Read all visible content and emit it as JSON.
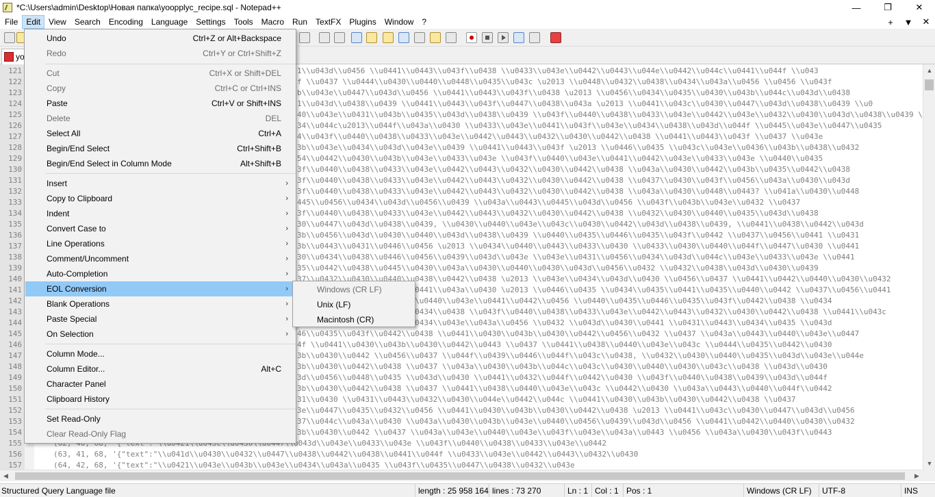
{
  "window": {
    "title": "*C:\\Users\\admin\\Desktop\\Новая папка\\yoopplyc_recipe.sql - Notepad++",
    "minimize": "—",
    "restore": "❐",
    "close": "✕"
  },
  "menubar": {
    "items": [
      "File",
      "Edit",
      "View",
      "Search",
      "Encoding",
      "Language",
      "Settings",
      "Tools",
      "Macro",
      "Run",
      "TextFX",
      "Plugins",
      "Window",
      "?"
    ],
    "right": [
      "+",
      "▼",
      "✕"
    ]
  },
  "tab": {
    "label": "yo"
  },
  "edit_menu": {
    "items": [
      {
        "label": "Undo",
        "shortcut": "Ctrl+Z or Alt+Backspace",
        "disabled": false
      },
      {
        "label": "Redo",
        "shortcut": "Ctrl+Y or Ctrl+Shift+Z",
        "disabled": true
      },
      {
        "label": "Cut",
        "shortcut": "Ctrl+X or Shift+DEL",
        "disabled": true
      },
      {
        "label": "Copy",
        "shortcut": "Ctrl+C or Ctrl+INS",
        "disabled": true
      },
      {
        "label": "Paste",
        "shortcut": "Ctrl+V or Shift+INS",
        "disabled": false
      },
      {
        "label": "Delete",
        "shortcut": "DEL",
        "disabled": true
      },
      {
        "label": "Select All",
        "shortcut": "Ctrl+A",
        "disabled": false
      },
      {
        "label": "Begin/End Select",
        "shortcut": "Ctrl+Shift+B",
        "disabled": false
      },
      {
        "label": "Begin/End Select in Column Mode",
        "shortcut": "Alt+Shift+B",
        "disabled": false
      },
      {
        "label": "Insert",
        "submenu": true
      },
      {
        "label": "Copy to Clipboard",
        "submenu": true
      },
      {
        "label": "Indent",
        "submenu": true
      },
      {
        "label": "Convert Case to",
        "submenu": true
      },
      {
        "label": "Line Operations",
        "submenu": true
      },
      {
        "label": "Comment/Uncomment",
        "submenu": true
      },
      {
        "label": "Auto-Completion",
        "submenu": true
      },
      {
        "label": "EOL Conversion",
        "submenu": true,
        "highlighted": true
      },
      {
        "label": "Blank Operations",
        "submenu": true
      },
      {
        "label": "Paste Special",
        "submenu": true
      },
      {
        "label": "On Selection",
        "submenu": true
      },
      {
        "label": "Column Mode...",
        "shortcut": ""
      },
      {
        "label": "Column Editor...",
        "shortcut": "Alt+C"
      },
      {
        "label": "Character Panel",
        "shortcut": ""
      },
      {
        "label": "Clipboard History",
        "shortcut": ""
      },
      {
        "label": "Set Read-Only",
        "shortcut": ""
      },
      {
        "label": "Clear Read-Only Flag",
        "shortcut": "",
        "disabled": true
      }
    ]
  },
  "eol_submenu": {
    "items": [
      {
        "label": "Windows (CR LF)",
        "disabled": true
      },
      {
        "label": "Unix (LF)",
        "disabled": false
      },
      {
        "label": "Macintosh (CR)",
        "disabled": false
      }
    ]
  },
  "editor": {
    "lines": [
      {
        "n": "121",
        "text": "1\\\\u043d\\\\u0456 \\\\u0441\\\\u0443\\\\u043f\\\\u0438 \\\\u0433\\\\u043e\\\\u0442\\\\u0443\\\\u044e\\\\u0442\\\\u044c\\\\u0441\\\\u044f \\\\u043"
      },
      {
        "n": "122",
        "text": "f \\\\u0437 \\\\u0444\\\\u0430\\\\u0440\\\\u0448\\\\u0435\\\\u043c \\u2013 \\\\u0448\\\\u0432\\\\u0438\\\\u0434\\\\u043a\\\\u0456 \\\\u0456 \\\\u043f"
      },
      {
        "n": "123",
        "text": "b\\\\u043e\\\\u0447\\\\u043d\\\\u0456 \\\\u0441\\\\u0443\\\\u043f\\\\u0438 \\u2013 \\\\u0456\\\\u0434\\\\u0435\\\\u0430\\\\u043b\\\\u044c\\\\u043d\\\\u0438"
      },
      {
        "n": "124",
        "text": "1\\\\u043d\\\\u0438\\\\u0439 \\\\u0441\\\\u0443\\\\u043f\\\\u0447\\\\u0438\\\\u043a \\u2013 \\\\u0441\\\\u043c\\\\u0430\\\\u0447\\\\u043d\\\\u0438\\\\u0439 \\\\u0"
      },
      {
        "n": "125",
        "text": "40\\\\u043e\\\\u0431\\\\u043b\\\\u0435\\\\u043d\\\\u0438\\\\u0439 \\\\u043f\\\\u0440\\\\u0438\\\\u0433\\\\u043e\\\\u0442\\\\u043e\\\\u0432\\\\u0430\\\\u043d\\\\u0438\\\\u0439 \\\\u0"
      },
      {
        "n": "126",
        "text": "34\\\\u044c\\u2013\\\\u044f\\\\u043a\\\\u0430 \\\\u0433\\\\u043e\\\\u0441\\\\u043f\\\\u043e\\\\u0434\\\\u0438\\\\u043d\\\\u044f \\\\u0445\\\\u043e\\\\u0447\\\\u0435"
      },
      {
        "n": "127",
        "text": "4\\\\u043f\\\\u0440\\\\u0438\\\\u0433\\\\u043e\\\\u0442\\\\u0443\\\\u0432\\\\u0430\\\\u0442\\\\u0438 \\\\u0441\\\\u0443\\\\u043f \\\\u0437 \\\\u043e"
      },
      {
        "n": "128",
        "text": "3b\\\\u043e\\\\u0434\\\\u043d\\\\u043e\\\\u0439 \\\\u0441\\\\u0443\\\\u043f \\u2013 \\\\u0446\\\\u0435 \\\\u043c\\\\u043e\\\\u0436\\\\u043b\\\\u0438\\\\u0432"
      },
      {
        "n": "129",
        "text": "54\\\\u0442\\\\u0430\\\\u043b\\\\u043e\\\\u0433\\\\u043e \\\\u043f\\\\u0440\\\\u043e\\\\u0441\\\\u0442\\\\u043e\\\\u0433\\\\u043e \\\\u0440\\\\u0435"
      },
      {
        "n": "130",
        "text": "3f\\\\u0440\\\\u0438\\\\u0433\\\\u043e\\\\u0442\\\\u0443\\\\u0432\\\\u0430\\\\u0442\\\\u0438 \\\\u043a\\\\u0430\\\\u0442\\\\u043b\\\\u0435\\\\u0442\\\\u0438"
      },
      {
        "n": "131",
        "text": "3f\\\\u0440\\\\u0438\\\\u0433\\\\u043e\\\\u0442\\\\u0443\\\\u0432\\\\u0430\\\\u0442\\\\u0438 \\\\u0437\\\\u0430\\\\u043f\\\\u0456\\\\u043a\\\\u0430\\\\u043d"
      },
      {
        "n": "132",
        "text": "3f\\\\u0440\\\\u0438\\\\u0433\\\\u043e\\\\u0442\\\\u0443\\\\u0432\\\\u0430\\\\u0442\\\\u0438 \\\\u043a\\\\u0430\\\\u0448\\\\u0443? \\\\u041a\\\\u0430\\\\u0448"
      },
      {
        "n": "133",
        "text": "445\\\\u0456\\\\u0434\\\\u043d\\\\u0456\\\\u0439 \\\\u043a\\\\u0443\\\\u0445\\\\u043d\\\\u0456 \\\\u043f\\\\u043b\\\\u043e\\\\u0432 \\\\u0437"
      },
      {
        "n": "134",
        "text": "3f\\\\u0440\\\\u0438\\\\u0433\\\\u043e\\\\u0442\\\\u0443\\\\u0432\\\\u0430\\\\u0442\\\\u0438 \\\\u0432\\\\u0430\\\\u0440\\\\u0435\\\\u043d\\\\u0438"
      },
      {
        "n": "135",
        "text": "30\\\\u0447\\\\u043d\\\\u0438\\\\u0439, \\\\u0430\\\\u0440\\\\u043e\\\\u043c\\\\u0430\\\\u0442\\\\u043d\\\\u0438\\\\u0439, \\\\u0441\\\\u0438\\\\u0442\\\\u043d"
      },
      {
        "n": "136",
        "text": "3b\\\\u0456\\\\u043d\\\\u0430\\\\u0440\\\\u043d\\\\u0438\\\\u0439 \\\\u0440\\\\u0435\\\\u0446\\\\u0435\\\\u043f\\\\u0442 \\\\u0437\\\\u0456\\\\u0441 \\\\u0431"
      },
      {
        "n": "137",
        "text": "3b\\\\u0443\\\\u0431\\\\u0446\\\\u0456 \\u2013 \\\\u0434\\\\u0440\\\\u0443\\\\u0433\\\\u0430 \\\\u0433\\\\u0430\\\\u0440\\\\u044f\\\\u0447\\\\u0430 \\\\u0441"
      },
      {
        "n": "138",
        "text": "30\\\\u0434\\\\u0438\\\\u0446\\\\u0456\\\\u0439\\\\u043d\\\\u043e \\\\u043e\\\\u0431\\\\u0456\\\\u0434\\\\u043d\\\\u044c\\\\u043e\\\\u0433\\\\u043e \\\\u0441"
      },
      {
        "n": "139",
        "text": "35\\\\u0442\\\\u0438\\\\u0445\\\\u0430\\\\u043a\\\\u0430\\\\u0440\\\\u0430\\\\u043d\\\\u0456\\\\u0432 \\\\u0432\\\\u0438\\\\u043d\\\\u0430\\\\u0439"
      },
      {
        "n": "140",
        "text": "37\\\\u0432\\\\u0430\\\\u0440\\\\u0438\\\\u0442\\\\u0438 \\u2013 \\\\u043e\\\\u0434\\\\u043d\\\\u0430 \\\\u0456\\\\u0437 \\\\u0441\\\\u0442\\\\u0440\\\\u0430\\\\u0432"
      },
      {
        "n": "141",
        "text": "37\\\\u0430\\\\u043a\\\\u0443\\\\u0441\\\\u043a\\\\u0430 \\u2013 \\\\u0446\\\\u0435 \\\\u0434\\\\u0435\\\\u0441\\\\u0435\\\\u0440\\\\u0442 \\\\u0437\\\\u0456\\\\u0441"
      },
      {
        "n": "142",
        "text": "56 \\\\u0442\\\\u0430 \\\\u043f\\\\u0440\\\\u043e\\\\u0441\\\\u0442\\\\u0456 \\\\u0440\\\\u0435\\\\u0446\\\\u0435\\\\u043f\\\\u0442\\\\u0438 \\\\u0434"
      },
      {
        "n": "143",
        "text": "37\\\\u0430\\\\u0432\\\\u0436\\\\u0434\\\\u0438 \\\\u043f\\\\u0440\\\\u0438\\\\u0433\\\\u043e\\\\u0442\\\\u0443\\\\u0432\\\\u0430\\\\u0442\\\\u0438 \\\\u0441\\\\u043c"
      },
      {
        "n": "144",
        "text": "56\\\\u0434\\\\u043f\\\\u0430\\\\u0434\\\\u043e\\\\u043a\\\\u0456 \\\\u0432 \\\\u043d\\\\u0430\\\\u0441 \\\\u0431\\\\u0443\\\\u0434\\\\u0435 \\\\u043d"
      },
      {
        "n": "145",
        "text": "46\\\\u0435\\\\u043f\\\\u0442\\\\u0438 \\\\u0441\\\\u0430\\\\u043b\\\\u0430\\\\u0442\\\\u0456\\\\u0432 \\\\u0437 \\\\u043a\\\\u0443\\\\u0440\\\\u043e\\\\u0447"
      },
      {
        "n": "146",
        "text": "4f \\\\u0441\\\\u0430\\\\u043b\\\\u0430\\\\u0442\\\\u0443 \\\\u0437 \\\\u0441\\\\u0438\\\\u0440\\\\u043e\\\\u043c \\\\u0444\\\\u0435\\\\u0442\\\\u0430"
      },
      {
        "n": "147",
        "text": "3b\\\\u0430\\\\u0442 \\\\u0456\\\\u0437 \\\\u044f\\\\u0439\\\\u0446\\\\u044f\\\\u043c\\\\u0438, \\\\u0432\\\\u0430\\\\u0440\\\\u0435\\\\u043d\\\\u043e\\\\u044e"
      },
      {
        "n": "148",
        "text": "3b\\\\u0430\\\\u0442\\\\u0438 \\\\u0437 \\\\u043a\\\\u0430\\\\u043b\\\\u044c\\\\u043c\\\\u0430\\\\u0440\\\\u0430\\\\u043c\\\\u0438 \\\\u043d\\\\u0430"
      },
      {
        "n": "149",
        "text": "3d\\\\u0456\\\\u0448\\\\u0435 \\\\u043d\\\\u0430 \\\\u0441\\\\u0432\\\\u044f\\\\u0442\\\\u0430 \\\\u043f\\\\u0440\\\\u0438\\\\u0439\\\\u043d\\\\u044f"
      },
      {
        "n": "150",
        "text": "3b\\\\u0430\\\\u0442\\\\u0438 \\\\u0437 \\\\u0441\\\\u0438\\\\u0440\\\\u043e\\\\u043c \\\\u0442\\\\u0430 \\\\u043a\\\\u0443\\\\u0440\\\\u044f\\\\u0442"
      },
      {
        "n": "151",
        "text": "31\\\\u0430 \\\\u0431\\\\u0443\\\\u0432\\\\u0430\\\\u044e\\\\u0442\\\\u044c \\\\u0441\\\\u0430\\\\u043b\\\\u0430\\\\u0442\\\\u0438 \\\\u0437"
      },
      {
        "n": "152",
        "text": "3e\\\\u0447\\\\u0435\\\\u0432\\\\u0456 \\\\u0441\\\\u0430\\\\u043b\\\\u0430\\\\u0442\\\\u0438 \\u2013 \\\\u0441\\\\u043c\\\\u0430\\\\u0447\\\\u043d\\\\u0456"
      },
      {
        "n": "153",
        "text": "37\\\\u044c\\\\u043a\\\\u0430 \\\\u043a\\\\u0430\\\\u043b\\\\u043e\\\\u0440\\\\u0456\\\\u0439\\\\u043d\\\\u0456 \\\\u0441\\\\u0442\\\\u0440\\\\u0430\\\\u0432"
      },
      {
        "n": "154",
        "text": "3b\\\\u0430\\\\u0442 \\\\u0437 \\\\u043a\\\\u043e\\\\u0440\\\\u043e\\\\u043f\\\\u043e\\\\u043a\\\\u0443 \\\\u0456 \\\\u043a\\\\u0430\\\\u043f\\\\u0443"
      },
      {
        "n": "155",
        "text": "(62, 40, 68, '{\"text\":\"\\\\u0421\\\\u043c\\\\u0430\\\\u0447\\\\u043d\\\\u043e\\\\u0433\\\\u043e \\\\u043f\\\\u0440\\\\u0438\\\\u0433\\\\u043e\\\\u0442"
      },
      {
        "n": "156",
        "text": "(63, 41, 68, '{\"text\":\"\\\\u041d\\\\u0430\\\\u0432\\\\u0447\\\\u0438\\\\u0442\\\\u0438\\\\u0441\\\\u044f \\\\u0433\\\\u043e\\\\u0442\\\\u0443\\\\u0432\\\\u0430"
      },
      {
        "n": "157",
        "text": "(64, 42, 68, '{\"text\":\"\\\\u0421\\\\u043e\\\\u043b\\\\u043e\\\\u0434\\\\u043a\\\\u0435 \\\\u043f\\\\u0435\\\\u0447\\\\u0438\\\\u0432\\\\u043e"
      }
    ]
  },
  "statusbar": {
    "filetype": "Structured Query Language file",
    "length": "length : 25 958 164",
    "lines": "lines : 73 270",
    "ln": "Ln : 1",
    "col": "Col : 1",
    "pos": "Pos : 1",
    "eol": "Windows (CR LF)",
    "encoding": "UTF-8",
    "mode": "INS"
  }
}
